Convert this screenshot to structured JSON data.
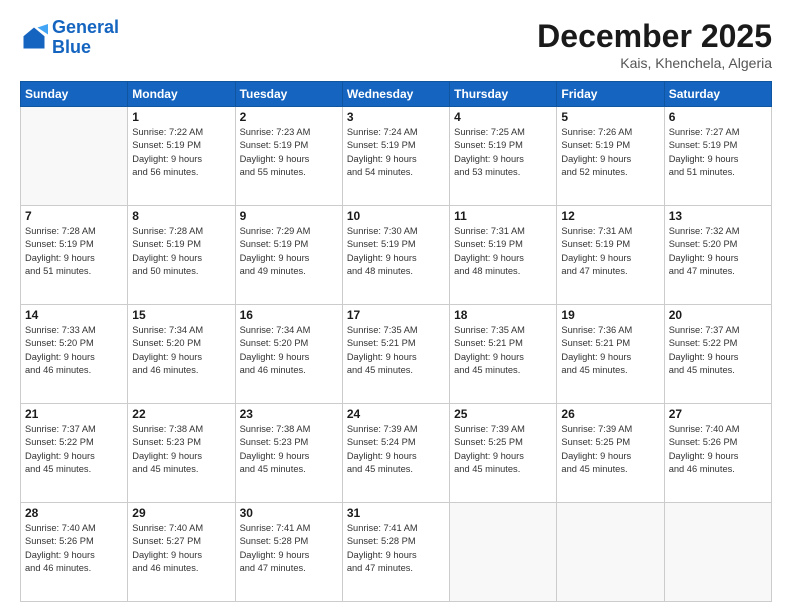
{
  "logo": {
    "line1": "General",
    "line2": "Blue"
  },
  "header": {
    "month_year": "December 2025",
    "location": "Kais, Khenchela, Algeria"
  },
  "days_of_week": [
    "Sunday",
    "Monday",
    "Tuesday",
    "Wednesday",
    "Thursday",
    "Friday",
    "Saturday"
  ],
  "weeks": [
    [
      {
        "day": "",
        "info": ""
      },
      {
        "day": "1",
        "info": "Sunrise: 7:22 AM\nSunset: 5:19 PM\nDaylight: 9 hours\nand 56 minutes."
      },
      {
        "day": "2",
        "info": "Sunrise: 7:23 AM\nSunset: 5:19 PM\nDaylight: 9 hours\nand 55 minutes."
      },
      {
        "day": "3",
        "info": "Sunrise: 7:24 AM\nSunset: 5:19 PM\nDaylight: 9 hours\nand 54 minutes."
      },
      {
        "day": "4",
        "info": "Sunrise: 7:25 AM\nSunset: 5:19 PM\nDaylight: 9 hours\nand 53 minutes."
      },
      {
        "day": "5",
        "info": "Sunrise: 7:26 AM\nSunset: 5:19 PM\nDaylight: 9 hours\nand 52 minutes."
      },
      {
        "day": "6",
        "info": "Sunrise: 7:27 AM\nSunset: 5:19 PM\nDaylight: 9 hours\nand 51 minutes."
      }
    ],
    [
      {
        "day": "7",
        "info": "Sunrise: 7:28 AM\nSunset: 5:19 PM\nDaylight: 9 hours\nand 51 minutes."
      },
      {
        "day": "8",
        "info": "Sunrise: 7:28 AM\nSunset: 5:19 PM\nDaylight: 9 hours\nand 50 minutes."
      },
      {
        "day": "9",
        "info": "Sunrise: 7:29 AM\nSunset: 5:19 PM\nDaylight: 9 hours\nand 49 minutes."
      },
      {
        "day": "10",
        "info": "Sunrise: 7:30 AM\nSunset: 5:19 PM\nDaylight: 9 hours\nand 48 minutes."
      },
      {
        "day": "11",
        "info": "Sunrise: 7:31 AM\nSunset: 5:19 PM\nDaylight: 9 hours\nand 48 minutes."
      },
      {
        "day": "12",
        "info": "Sunrise: 7:31 AM\nSunset: 5:19 PM\nDaylight: 9 hours\nand 47 minutes."
      },
      {
        "day": "13",
        "info": "Sunrise: 7:32 AM\nSunset: 5:20 PM\nDaylight: 9 hours\nand 47 minutes."
      }
    ],
    [
      {
        "day": "14",
        "info": "Sunrise: 7:33 AM\nSunset: 5:20 PM\nDaylight: 9 hours\nand 46 minutes."
      },
      {
        "day": "15",
        "info": "Sunrise: 7:34 AM\nSunset: 5:20 PM\nDaylight: 9 hours\nand 46 minutes."
      },
      {
        "day": "16",
        "info": "Sunrise: 7:34 AM\nSunset: 5:20 PM\nDaylight: 9 hours\nand 46 minutes."
      },
      {
        "day": "17",
        "info": "Sunrise: 7:35 AM\nSunset: 5:21 PM\nDaylight: 9 hours\nand 45 minutes."
      },
      {
        "day": "18",
        "info": "Sunrise: 7:35 AM\nSunset: 5:21 PM\nDaylight: 9 hours\nand 45 minutes."
      },
      {
        "day": "19",
        "info": "Sunrise: 7:36 AM\nSunset: 5:21 PM\nDaylight: 9 hours\nand 45 minutes."
      },
      {
        "day": "20",
        "info": "Sunrise: 7:37 AM\nSunset: 5:22 PM\nDaylight: 9 hours\nand 45 minutes."
      }
    ],
    [
      {
        "day": "21",
        "info": "Sunrise: 7:37 AM\nSunset: 5:22 PM\nDaylight: 9 hours\nand 45 minutes."
      },
      {
        "day": "22",
        "info": "Sunrise: 7:38 AM\nSunset: 5:23 PM\nDaylight: 9 hours\nand 45 minutes."
      },
      {
        "day": "23",
        "info": "Sunrise: 7:38 AM\nSunset: 5:23 PM\nDaylight: 9 hours\nand 45 minutes."
      },
      {
        "day": "24",
        "info": "Sunrise: 7:39 AM\nSunset: 5:24 PM\nDaylight: 9 hours\nand 45 minutes."
      },
      {
        "day": "25",
        "info": "Sunrise: 7:39 AM\nSunset: 5:25 PM\nDaylight: 9 hours\nand 45 minutes."
      },
      {
        "day": "26",
        "info": "Sunrise: 7:39 AM\nSunset: 5:25 PM\nDaylight: 9 hours\nand 45 minutes."
      },
      {
        "day": "27",
        "info": "Sunrise: 7:40 AM\nSunset: 5:26 PM\nDaylight: 9 hours\nand 46 minutes."
      }
    ],
    [
      {
        "day": "28",
        "info": "Sunrise: 7:40 AM\nSunset: 5:26 PM\nDaylight: 9 hours\nand 46 minutes."
      },
      {
        "day": "29",
        "info": "Sunrise: 7:40 AM\nSunset: 5:27 PM\nDaylight: 9 hours\nand 46 minutes."
      },
      {
        "day": "30",
        "info": "Sunrise: 7:41 AM\nSunset: 5:28 PM\nDaylight: 9 hours\nand 47 minutes."
      },
      {
        "day": "31",
        "info": "Sunrise: 7:41 AM\nSunset: 5:28 PM\nDaylight: 9 hours\nand 47 minutes."
      },
      {
        "day": "",
        "info": ""
      },
      {
        "day": "",
        "info": ""
      },
      {
        "day": "",
        "info": ""
      }
    ]
  ]
}
